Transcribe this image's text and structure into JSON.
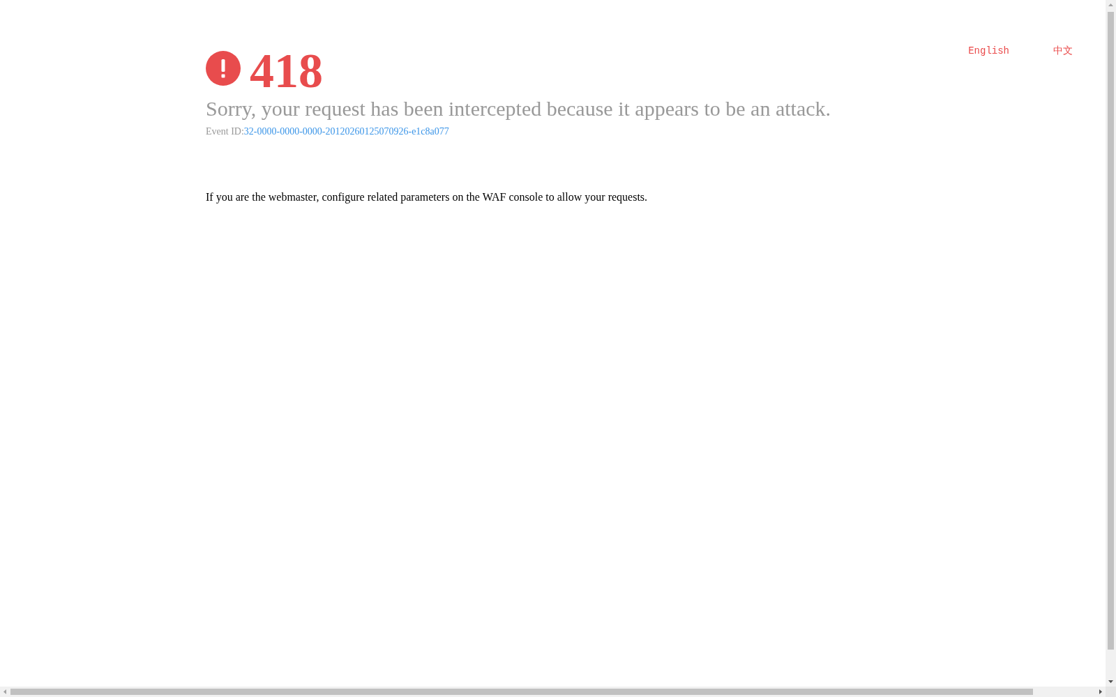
{
  "language_links": [
    {
      "label": "English"
    },
    {
      "label": "中文"
    }
  ],
  "error": {
    "code": "418",
    "message": "Sorry, your request has been intercepted because it appears to be an attack.",
    "event_id_label": "Event ID:",
    "event_id": "32-0000-0000-0000-20120260125070926-e1c8a077",
    "note": "If you are the webmaster, configure related parameters on the WAF console to allow your requests."
  }
}
